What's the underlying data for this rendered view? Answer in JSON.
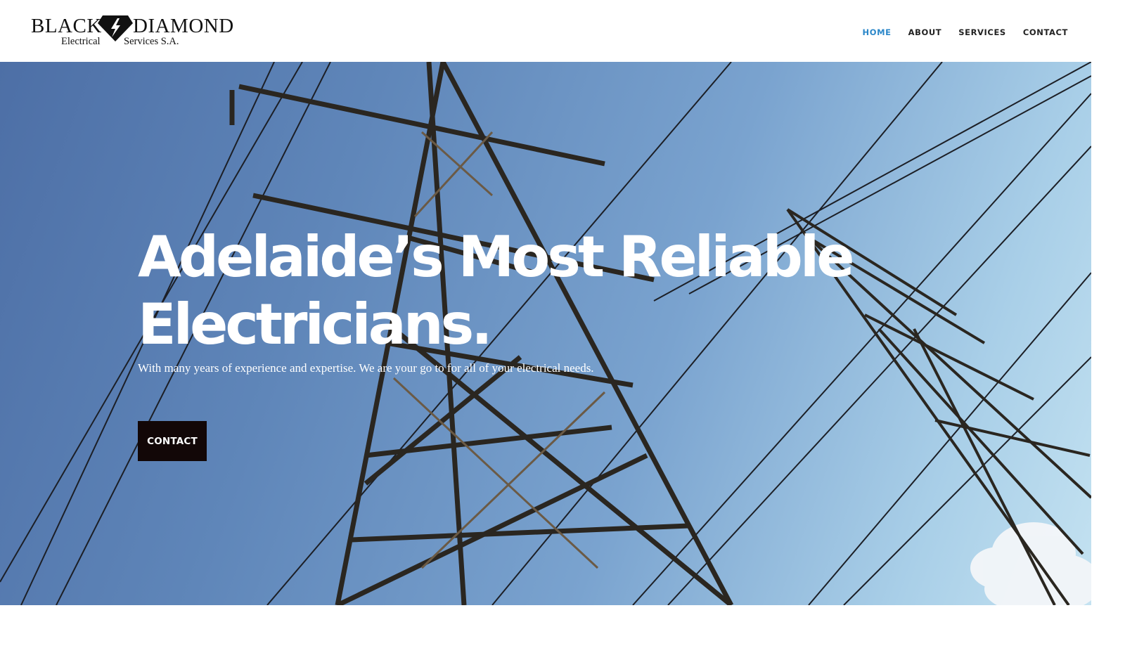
{
  "brand": {
    "name_left": "BLACK",
    "name_right": "DIAMOND",
    "sub_left": "Electrical",
    "sub_right": "Services S.A.",
    "gem_icon": "diamond-lightning-icon"
  },
  "nav": {
    "items": [
      {
        "label": "HOME",
        "active": true
      },
      {
        "label": "ABOUT",
        "active": false
      },
      {
        "label": "SERVICES",
        "active": false
      },
      {
        "label": "CONTACT",
        "active": false
      }
    ],
    "active_color": "#2b87c9"
  },
  "hero": {
    "title_line1": "Adelaide’s Most Reliable",
    "title_line2": "Electricians.",
    "subtitle": "With many years of experience and expertise. We are your go to for all of your electrical needs.",
    "cta_label": "CONTACT",
    "background": "photo of electricity pylons against blue sky",
    "cta_color": "#120707"
  }
}
